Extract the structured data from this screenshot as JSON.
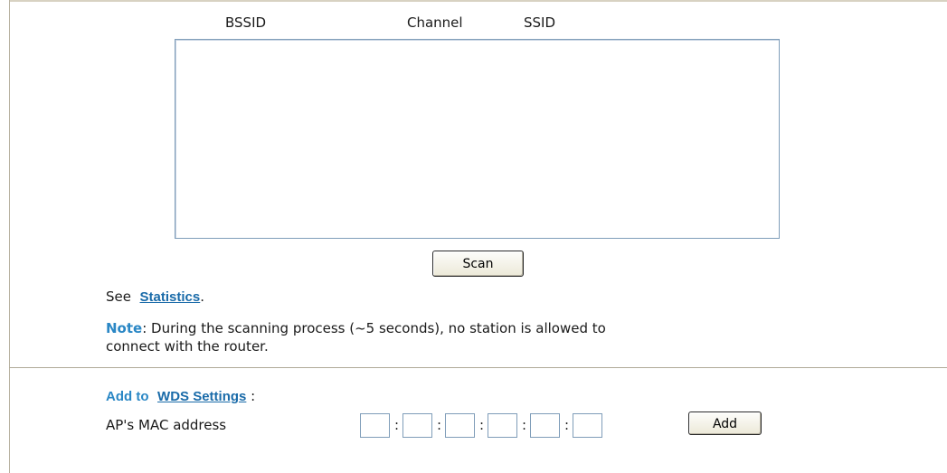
{
  "table": {
    "columns": [
      "BSSID",
      "Channel",
      "SSID"
    ],
    "rows": []
  },
  "scan_button": "Scan",
  "see": {
    "prefix": "See",
    "link": "Statistics",
    "suffix": "."
  },
  "note": {
    "label": "Note",
    "line1": ": During the scanning process (~5 seconds), no station is allowed to",
    "line2": "connect with the router."
  },
  "add_to": {
    "label": "Add to",
    "link": "WDS Settings",
    "suffix": " :"
  },
  "mac": {
    "label": "AP's MAC address",
    "separator": ":",
    "octets": [
      "",
      "",
      "",
      "",
      "",
      ""
    ],
    "add_label": "Add"
  }
}
